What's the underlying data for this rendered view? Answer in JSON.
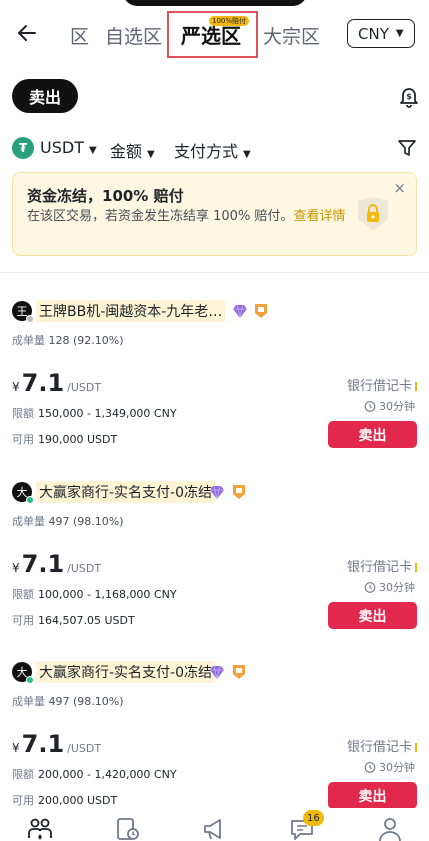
{
  "header": {
    "tabs": [
      {
        "label": "区",
        "state": "partial"
      },
      {
        "label": "自选区"
      },
      {
        "label": "严选区",
        "state": "active",
        "badge": "100%赔付"
      },
      {
        "label": "大宗区"
      }
    ],
    "currency": "CNY"
  },
  "trade_toggle": {
    "label": "卖出"
  },
  "filters": {
    "coin": "USDT",
    "coin_icon_glyph": "₮",
    "amount": "金额",
    "payment": "支付方式"
  },
  "banner": {
    "title": "资金冻结，100% 赔付",
    "text": "在该区交易，若资金发生冻结享 100% 赔付。",
    "link": "查看详情",
    "close": "×"
  },
  "listings": [
    {
      "avatar": "王",
      "merchant": "王牌BB机-闽越资本-九年老…",
      "online": false,
      "orders_label": "成单量",
      "orders": "128 (92.10%)",
      "currency_symbol": "¥",
      "price": "7.1",
      "unit": "/USDT",
      "limit_label": "限额",
      "limit": "150,000 - 1,349,000 CNY",
      "available_label": "可用",
      "available": "190,000 USDT",
      "payment": "银行借记卡",
      "time": "30分钟",
      "action": "卖出"
    },
    {
      "avatar": "大",
      "merchant": "大赢家商行-实名支付-0冻结",
      "online": true,
      "orders_label": "成单量",
      "orders": "497 (98.10%)",
      "currency_symbol": "¥",
      "price": "7.1",
      "unit": "/USDT",
      "limit_label": "限额",
      "limit": "100,000 - 1,168,000 CNY",
      "available_label": "可用",
      "available": "164,507.05 USDT",
      "payment": "银行借记卡",
      "time": "30分钟",
      "action": "卖出"
    },
    {
      "avatar": "大",
      "merchant": "大赢家商行-实名支付-0冻结",
      "online": true,
      "orders_label": "成单量",
      "orders": "497 (98.10%)",
      "currency_symbol": "¥",
      "price": "7.1",
      "unit": "/USDT",
      "limit_label": "限额",
      "limit": "200,000 - 1,420,000 CNY",
      "available_label": "可用",
      "available": "200,000 USDT",
      "payment": "银行借记卡",
      "time": "30分钟",
      "action": "卖出"
    }
  ],
  "bottom_nav": {
    "items": [
      "p2p-icon",
      "orders-icon",
      "ads-icon",
      "chat-icon",
      "profile-icon"
    ],
    "chat_badge": "16"
  },
  "colors": {
    "accent": "#f0b90b",
    "sell": "#e2284d",
    "highlight": "#e0525a"
  }
}
